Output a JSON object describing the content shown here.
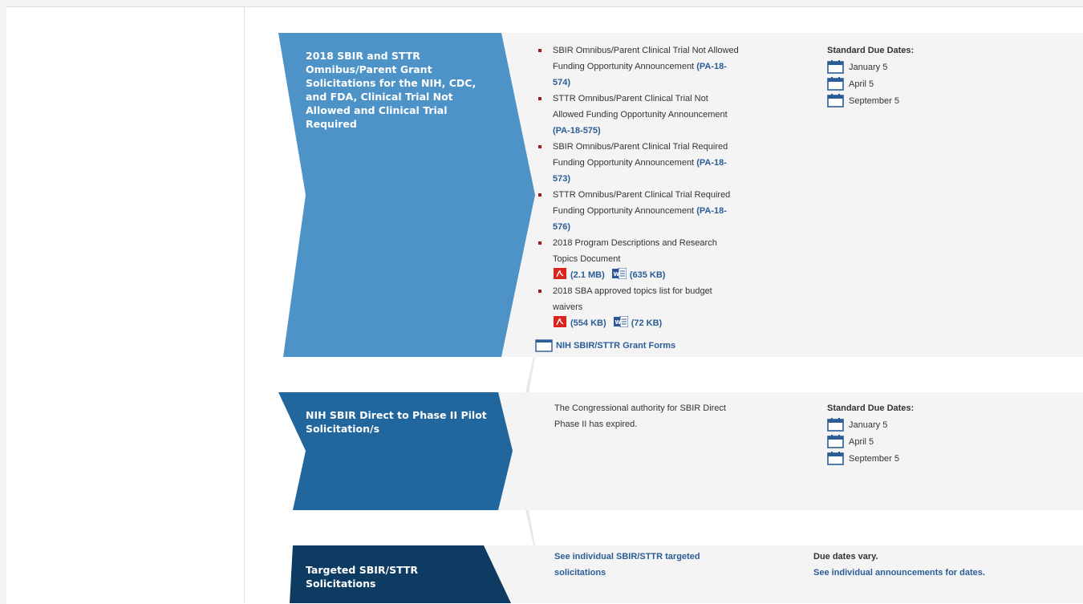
{
  "rows": [
    {
      "title": "2018 SBIR and STTR Omnibus/Parent Grant Solicitations for the NIH, CDC, and FDA, Clinical Trial Not Allowed and Clinical Trial Required",
      "title_lines": [
        "2018 SBIR and STTR",
        "Omnibus/Parent Grant",
        "Solicitations for the NIH, CDC,",
        "and FDA, Clinical Trial Not",
        "Allowed and Clinical Trial",
        "Required"
      ],
      "color": "#4d93c8",
      "items": [
        {
          "text_lines": [
            "SBIR Omnibus/Parent Clinical Trial Not Allowed",
            "Funding Opportunity Announcement "
          ],
          "link": "(PA-18-",
          "link2": "574)"
        },
        {
          "text_lines": [
            "STTR Omnibus/Parent Clinical Trial Not",
            "Allowed Funding Opportunity Announcement"
          ],
          "link": "(PA-18-575)"
        },
        {
          "text_lines": [
            "SBIR Omnibus/Parent Clinical Trial Required",
            "Funding Opportunity Announcement "
          ],
          "link": "(PA-18-",
          "link2": "573)"
        },
        {
          "text_lines": [
            "STTR Omnibus/Parent Clinical Trial Required",
            "Funding Opportunity Announcement "
          ],
          "link": "(PA-18-",
          "link2": "576)"
        },
        {
          "text_lines": [
            "2018 Program Descriptions and Research",
            "Topics Document"
          ],
          "pdf": "(2.1 MB)",
          "word": "(635 KB)"
        },
        {
          "text_lines": [
            "2018 SBA approved topics list for budget",
            "waivers"
          ],
          "pdf": "(554 KB)",
          "word": "(72 KB)"
        }
      ],
      "forms_link": "NIH SBIR/STTR Grant Forms",
      "due_heading": "Standard Due Dates:",
      "due_dates": [
        "January 5",
        "April 5",
        "September 5"
      ]
    },
    {
      "title": "NIH SBIR Direct to Phase II Pilot Solicitation/s",
      "title_lines": [
        "NIH SBIR Direct to Phase II Pilot",
        "Solicitation/s"
      ],
      "color": "#21669c",
      "text_lines": [
        "The Congressional authority for SBIR Direct",
        "Phase II has expired."
      ],
      "due_heading": "Standard Due Dates:",
      "due_dates": [
        "January 5",
        "April 5",
        "September 5"
      ]
    },
    {
      "title": "Targeted SBIR/STTR Solicitations",
      "title_lines": [
        "Targeted SBIR/STTR",
        "Solicitations"
      ],
      "color": "#0d3b62",
      "link_lines": [
        "See individual SBIR/STTR targeted",
        "solicitations"
      ],
      "due_heading": "Due dates vary.",
      "due_link": "See individual announcements for dates."
    }
  ],
  "icons": {
    "calendar": "calendar-icon",
    "pdf": "pdf-icon",
    "word": "word-icon",
    "window": "window-icon"
  },
  "colors": {
    "link": "#2a5d96",
    "bullet": "#9b1c1c",
    "panel": "#f4f4f4"
  }
}
